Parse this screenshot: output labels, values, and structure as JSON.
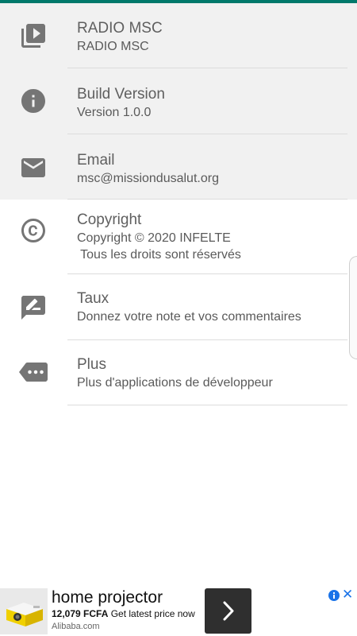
{
  "colors": {
    "accent": "#00796b",
    "icon": "#757575",
    "shaded_bg": "#f1f1f1",
    "ad_link": "#1a73e8"
  },
  "rows": [
    {
      "icon": "video-library-icon",
      "title": "RADIO MSC",
      "sub": "RADIO MSC"
    },
    {
      "icon": "info-icon",
      "title": "Build Version",
      "sub": "Version 1.0.0"
    },
    {
      "icon": "email-icon",
      "title": "Email",
      "sub": "msc@missiondusalut.org"
    },
    {
      "icon": "copyright-icon",
      "title": "Copyright",
      "sub": "Copyright © 2020 INFELTE\n Tous les droits sont réservés"
    },
    {
      "icon": "rate-review-icon",
      "title": "Taux",
      "sub": "Donnez votre note et vos commentaires"
    },
    {
      "icon": "more-apps-icon",
      "title": "Plus",
      "sub": "Plus d'applications de développeur"
    }
  ],
  "ad": {
    "headline": "home projector",
    "price": "12,079 FCFA",
    "price_note": "Get latest price now",
    "domain": "Alibaba.com",
    "close": "✕"
  }
}
